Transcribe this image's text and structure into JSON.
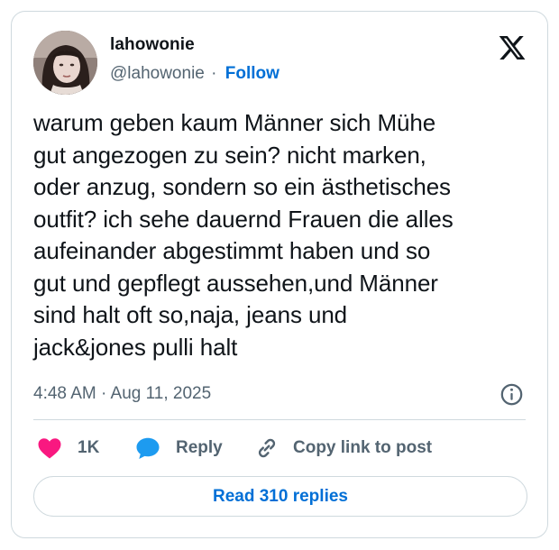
{
  "author": {
    "display_name": "lahowonie",
    "handle": "@lahowonie",
    "separator": "·",
    "follow_label": "Follow"
  },
  "tweet": {
    "text": "warum geben kaum Männer sich Mühe\ngut angezogen zu sein? nicht marken,\noder anzug, sondern so ein ästhetisches\noutfit? ich sehe dauernd Frauen die alles\naufeinander abgestimmt haben und so\ngut und gepflegt aussehen,und Männer\nsind halt oft so,naja, jeans und\njack&jones pulli halt",
    "timestamp": "4:48 AM · Aug 11, 2025"
  },
  "actions": {
    "like_count": "1K",
    "reply_label": "Reply",
    "copy_label": "Copy link to post"
  },
  "read_replies_label": "Read 310 replies",
  "icons": {
    "logo": "x-logo-icon",
    "info": "info-icon",
    "like": "heart-icon",
    "reply": "speech-bubble-icon",
    "copy": "link-icon"
  },
  "colors": {
    "accent": "#006fd6",
    "like": "#f91880",
    "reply": "#1d9bf0",
    "secondary_text": "#536471",
    "border": "#cfd9de"
  }
}
